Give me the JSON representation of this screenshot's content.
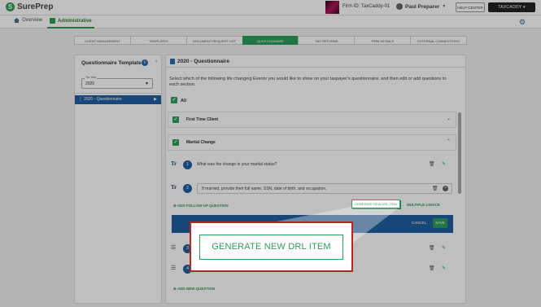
{
  "app": {
    "logo_text": "SurePrep",
    "logo_mark": "S"
  },
  "topbar": {
    "firm_id": "Firm ID: TaxCaddy-01",
    "user_name": "Paul Preparer",
    "help_center": "HELP CENTER",
    "taxcaddy": "TAXCADDY"
  },
  "nav": {
    "items": [
      {
        "label": "Overview"
      },
      {
        "label": "Administrative"
      }
    ]
  },
  "tabs": [
    {
      "label": "CLIENT MANAGEMENT"
    },
    {
      "label": "TEMPLATES"
    },
    {
      "label": "DOCUMENT REQUEST LIST"
    },
    {
      "label": "QUESTIONNAIRE"
    },
    {
      "label": "TAX RETURNS"
    },
    {
      "label": "FIRM DETAILS"
    },
    {
      "label": "EXTERNAL CONNECTIONS"
    }
  ],
  "left_panel": {
    "title": "Questionnaire Templates",
    "tax_year_label": "Tax Year",
    "tax_year_value": "2020",
    "selected_item": "2020 - Questionnaire"
  },
  "main_panel": {
    "title": "2020 - Questionnaire",
    "description": "Select which of the following life changing Events you would like to show on your taxpayer's questionnaire, and then edit or add questions to each section.",
    "all_label": "All",
    "sections": [
      {
        "label": "First Time Client"
      },
      {
        "label": "Marital Change"
      }
    ],
    "questions": [
      {
        "number": "1",
        "text": "What was the change in your marital status?"
      },
      {
        "number": "2",
        "text": "If married, provide their full name, SSN, date of birth, and occupation."
      }
    ],
    "add_follow_up": "ADD FOLLOW-UP QUESTION",
    "generate_drl": "GENERATE NEW DRL ITEM",
    "multiple_choice": "MULTIPLE CHOICE",
    "cancel": "CANCEL",
    "save": "SAVE",
    "hidden_numbers": [
      "3",
      "4"
    ],
    "add_new_question": "ADD NEW QUESTION"
  },
  "callout": {
    "button_label": "GENERATE NEW DRL ITEM"
  },
  "colors": {
    "brand_green": "#2e9e5a",
    "primary_blue": "#1f5fa0",
    "callout_border": "#b0281f"
  }
}
